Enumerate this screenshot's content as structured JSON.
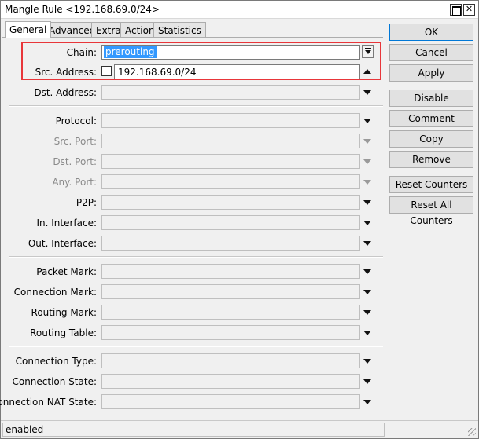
{
  "window": {
    "title": "Mangle Rule <192.168.69.0/24>"
  },
  "tabs": [
    {
      "label": "General"
    },
    {
      "label": "Advanced"
    },
    {
      "label": "Extra"
    },
    {
      "label": "Action"
    },
    {
      "label": "Statistics"
    }
  ],
  "form": {
    "chain": {
      "label": "Chain:",
      "value": "prerouting"
    },
    "src_address": {
      "label": "Src. Address:",
      "value": "192.168.69.0/24",
      "negate": false
    },
    "dst_address": {
      "label": "Dst. Address:"
    },
    "protocol": {
      "label": "Protocol:"
    },
    "src_port": {
      "label": "Src. Port:"
    },
    "dst_port": {
      "label": "Dst. Port:"
    },
    "any_port": {
      "label": "Any. Port:"
    },
    "p2p": {
      "label": "P2P:"
    },
    "in_interface": {
      "label": "In. Interface:"
    },
    "out_interface": {
      "label": "Out. Interface:"
    },
    "packet_mark": {
      "label": "Packet Mark:"
    },
    "connection_mark": {
      "label": "Connection Mark:"
    },
    "routing_mark": {
      "label": "Routing Mark:"
    },
    "routing_table": {
      "label": "Routing Table:"
    },
    "connection_type": {
      "label": "Connection Type:"
    },
    "connection_state": {
      "label": "Connection State:"
    },
    "connection_nat_state": {
      "label": "Connection NAT State:"
    }
  },
  "buttons": {
    "ok": "OK",
    "cancel": "Cancel",
    "apply": "Apply",
    "disable": "Disable",
    "comment": "Comment",
    "copy": "Copy",
    "remove": "Remove",
    "reset_counters": "Reset Counters",
    "reset_all_counters": "Reset All Counters"
  },
  "status": {
    "text": "enabled"
  },
  "colors": {
    "highlight": "#e8363a",
    "selection": "#3399ff",
    "primary_border": "#0078d7"
  },
  "icons": {
    "maximize": "maximize-icon",
    "close": "close-icon",
    "dropdown": "chevron-down-icon"
  }
}
